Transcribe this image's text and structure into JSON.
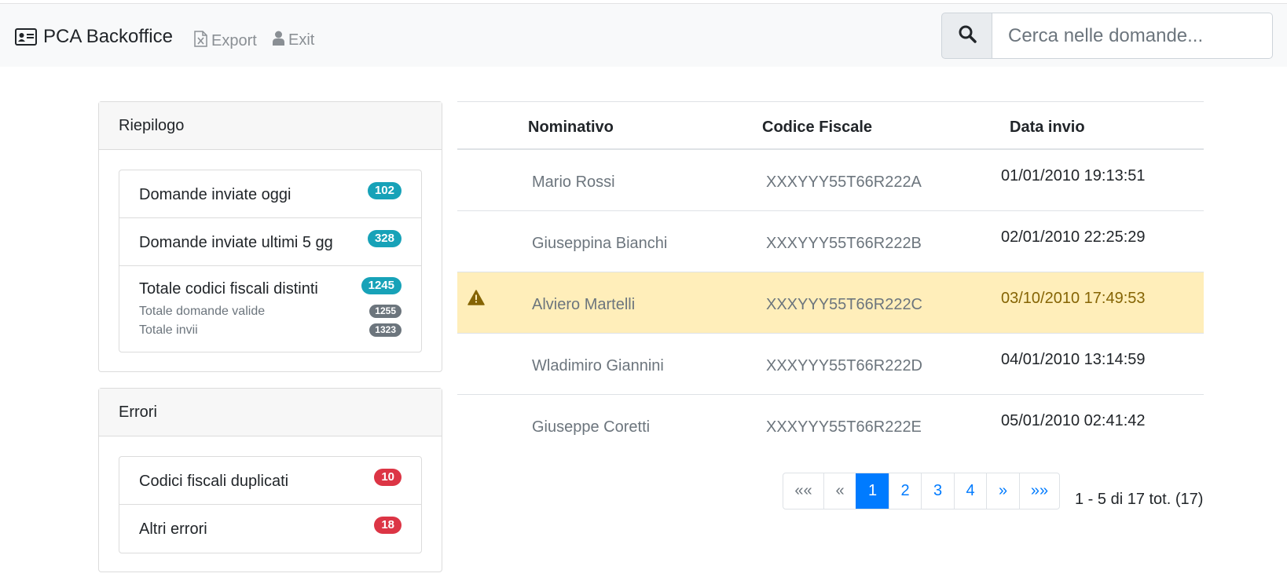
{
  "navbar": {
    "brand": "PCA Backoffice",
    "export_label": "Export",
    "exit_label": "Exit",
    "search_placeholder": "Cerca nelle domande..."
  },
  "riepilogo": {
    "title": "Riepilogo",
    "items": [
      {
        "label": "Domande inviate oggi",
        "badge": "102"
      },
      {
        "label": "Domande inviate ultimi 5 gg",
        "badge": "328"
      },
      {
        "label": "Totale codici fiscali distinti",
        "badge": "1245",
        "sub": [
          {
            "label": "Totale domande valide",
            "badge": "1255"
          },
          {
            "label": "Totale invii",
            "badge": "1323"
          }
        ]
      }
    ]
  },
  "errori": {
    "title": "Errori",
    "items": [
      {
        "label": "Codici fiscali duplicati",
        "badge": "10"
      },
      {
        "label": "Altri errori",
        "badge": "18"
      }
    ]
  },
  "table": {
    "headers": {
      "name": "Nominativo",
      "cf": "Codice Fiscale",
      "date": "Data invio"
    },
    "rows": [
      {
        "name": "Mario Rossi",
        "cf": "XXXYYY55T66R222A",
        "date": "01/01/2010 19:13:51",
        "warning": false
      },
      {
        "name": "Giuseppina Bianchi",
        "cf": "XXXYYY55T66R222B",
        "date": "02/01/2010 22:25:29",
        "warning": false
      },
      {
        "name": "Alviero Martelli",
        "cf": "XXXYYY55T66R222C",
        "date": "03/10/2010 17:49:53",
        "warning": true
      },
      {
        "name": "Wladimiro Giannini",
        "cf": "XXXYYY55T66R222D",
        "date": "04/01/2010 13:14:59",
        "warning": false
      },
      {
        "name": "Giuseppe Coretti",
        "cf": "XXXYYY55T66R222E",
        "date": "05/01/2010 02:41:42",
        "warning": false
      }
    ]
  },
  "pagination": {
    "first": "««",
    "prev": "«",
    "pages": [
      "1",
      "2",
      "3",
      "4"
    ],
    "active_page": "1",
    "next": "»",
    "last": "»»",
    "info": "1 - 5 di 17 tot. (17)"
  },
  "colors": {
    "info_badge": "#17a2b8",
    "danger_badge": "#dc3545",
    "secondary_badge": "#6c757d",
    "warning_row": "#ffeeba",
    "primary": "#007bff"
  },
  "icons": {
    "brand": "id-card-icon",
    "export": "file-excel-icon",
    "exit": "user-icon",
    "search": "search-icon",
    "row_warning": "warning-icon"
  }
}
